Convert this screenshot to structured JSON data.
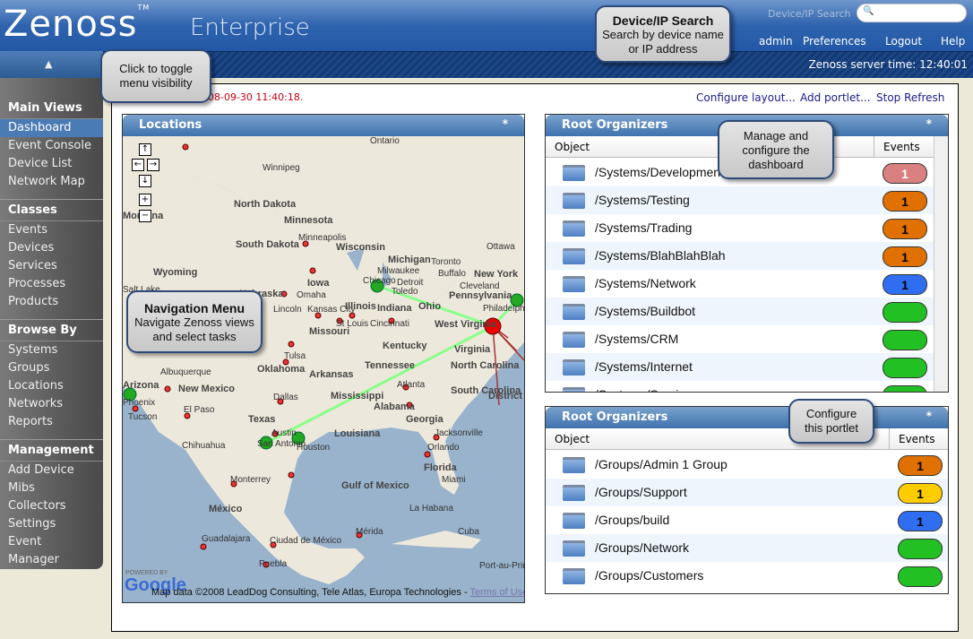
{
  "header": {
    "logo": "Zenoss",
    "tm": "TM",
    "edition": "Enterprise",
    "search_label": "Device/IP Search",
    "search_placeholder": "",
    "links": [
      "admin",
      "Preferences",
      "Logout",
      "Help"
    ],
    "server_time": "Zenoss server time: 12:40:01",
    "toggle_icon": "▲"
  },
  "sidebar": [
    {
      "heading": "Main Views",
      "items": [
        "Dashboard",
        "Event Console",
        "Device List",
        "Network Map"
      ]
    },
    {
      "heading": "Classes",
      "items": [
        "Events",
        "Devices",
        "Services",
        "Processes",
        "Products"
      ]
    },
    {
      "heading": "Browse By",
      "items": [
        "Systems",
        "Groups",
        "Locations",
        "Networks",
        "Reports"
      ]
    },
    {
      "heading": "Management",
      "items": [
        "Add Device",
        "Mibs",
        "Collectors",
        "Settings",
        "Event Manager"
      ]
    }
  ],
  "dashboard": {
    "timestamp": "08-09-30 11:40:18.",
    "links": [
      "Configure layout...",
      "Add portlet...",
      "Stop Refresh"
    ]
  },
  "locations": {
    "title": "Locations",
    "star": "*",
    "map_controls": [
      "↑",
      "←",
      "→",
      "↓",
      "+",
      "−"
    ],
    "labels": [
      "Ontario",
      "Winnipeg",
      "North Dakota",
      "Minnesota",
      "South Dakota",
      "Wyoming",
      "Montana",
      "Minneapolis",
      "Wisconsin",
      "Michigan",
      "Milwaukee",
      "Chicago",
      "Detroit",
      "Toronto",
      "Ottawa",
      "Buffalo",
      "Cleveland",
      "Toledo",
      "New York",
      "Pennsylvania",
      "Philadelphia",
      "Iowa",
      "Nebraska",
      "Omaha",
      "Lincoln",
      "Kansas City",
      "Illinois",
      "Indiana",
      "Ohio",
      "Missouri",
      "St Louis",
      "Cincinnati",
      "West Virginia",
      "Kentucky",
      "Virginia",
      "Tennessee",
      "North Carolina",
      "Tulsa",
      "Oklahoma",
      "Arkansas",
      "Albuquerque",
      "New Mexico",
      "Arizona",
      "Phoenix",
      "Tucson",
      "El Paso",
      "Dallas",
      "Texas",
      "Mississippi",
      "Alabama",
      "Atlanta",
      "South Carolina",
      "Georgia",
      "District of Columbia",
      "Austin",
      "San Antonio",
      "Houston",
      "Louisiana",
      "Jacksonville",
      "Orlando",
      "Florida",
      "Miami",
      "Chihuahua",
      "Monterrey",
      "Gulf of Mexico",
      "México",
      "La Habana",
      "Cuba",
      "Mérida",
      "Guadalajara",
      "Ciudad de México",
      "Puebla",
      "Port-au-Prince",
      "Salt Lake"
    ],
    "powered_by": "POWERED BY",
    "google": "Google",
    "attribution": "Map data ©2008 LeadDog Consulting, Tele Atlas, Europa Technologies - ",
    "terms": "Terms of Use"
  },
  "organizers_systems": {
    "title": "Root Organizers",
    "star": "*",
    "col_object": "Object",
    "col_events": "Events",
    "rows": [
      {
        "name": "/Systems/Development",
        "count": "1",
        "color": "#d98080"
      },
      {
        "name": "/Systems/Testing",
        "count": "1",
        "color": "#e07000"
      },
      {
        "name": "/Systems/Trading",
        "count": "1",
        "color": "#e07000"
      },
      {
        "name": "/Systems/BlahBlahBlah",
        "count": "1",
        "color": "#e07000"
      },
      {
        "name": "/Systems/Network",
        "count": "1",
        "color": "#2f6ef0"
      },
      {
        "name": "/Systems/Buildbot",
        "count": "",
        "color": "#22c022"
      },
      {
        "name": "/Systems/CRM",
        "count": "",
        "color": "#22c022"
      },
      {
        "name": "/Systems/Internet",
        "count": "",
        "color": "#22c022"
      },
      {
        "name": "/Systems/Services",
        "count": "",
        "color": "#22c022"
      }
    ]
  },
  "organizers_groups": {
    "title": "Root Organizers",
    "star": "*",
    "col_object": "Object",
    "col_events": "Events",
    "rows": [
      {
        "name": "/Groups/Admin 1 Group",
        "count": "1",
        "color": "#e07000"
      },
      {
        "name": "/Groups/Support",
        "count": "1",
        "color": "#ffcc00"
      },
      {
        "name": "/Groups/build",
        "count": "1",
        "color": "#2f6ef0"
      },
      {
        "name": "/Groups/Network",
        "count": "",
        "color": "#22c022"
      },
      {
        "name": "/Groups/Customers",
        "count": "",
        "color": "#22c022"
      }
    ]
  },
  "callouts": {
    "search": {
      "title": "Device/IP Search",
      "text": "Search by device name or IP address"
    },
    "toggle": {
      "text": "Click to toggle menu visibility"
    },
    "nav": {
      "title": "Navigation Menu",
      "text": "Navigate Zenoss views and select tasks"
    },
    "manage": {
      "text": "Manage and configure the dashboard"
    },
    "portlet": {
      "text": "Configure this portlet"
    }
  }
}
